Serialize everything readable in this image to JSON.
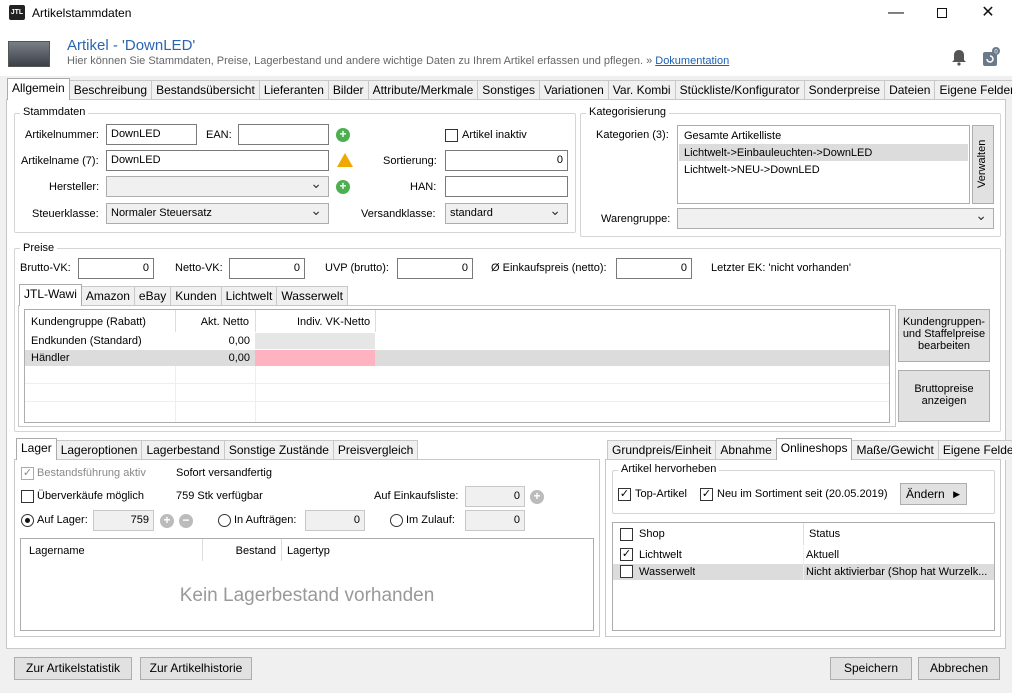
{
  "window": {
    "title": "Artikelstammdaten",
    "icon_text": "JTL"
  },
  "header": {
    "title": "Artikel - 'DownLED'",
    "description": "Hier können Sie Stammdaten, Preise, Lagerbestand und andere wichtige Daten zu Ihrem Artikel erfassen und pflegen.  »",
    "doc_link": "Dokumentation"
  },
  "main_tabs": [
    "Allgemein",
    "Beschreibung",
    "Bestandsübersicht",
    "Lieferanten",
    "Bilder",
    "Attribute/Merkmale",
    "Sonstiges",
    "Variationen",
    "Var. Kombi",
    "Stückliste/Konfigurator",
    "Sonderpreise",
    "Dateien",
    "Eigene Felder"
  ],
  "stammdaten": {
    "title": "Stammdaten",
    "artikelnummer_label": "Artikelnummer:",
    "artikelnummer": "DownLED",
    "ean_label": "EAN:",
    "ean": "",
    "inaktiv_label": "Artikel inaktiv",
    "artikelname_label": "Artikelname (7):",
    "artikelname": "DownLED",
    "sortierung_label": "Sortierung:",
    "sortierung": "0",
    "hersteller_label": "Hersteller:",
    "hersteller": "",
    "han_label": "HAN:",
    "han": "",
    "steuerklasse_label": "Steuerklasse:",
    "steuerklasse": "Normaler Steuersatz",
    "versandklasse_label": "Versandklasse:",
    "versandklasse": "standard"
  },
  "kategorisierung": {
    "title": "Kategorisierung",
    "kategorien_label": "Kategorien (3):",
    "items": [
      "Gesamte Artikelliste",
      "Lichtwelt->Einbauleuchten->DownLED",
      "Lichtwelt->NEU->DownLED"
    ],
    "verwalten": "Verwalten",
    "warengruppe_label": "Warengruppe:",
    "warengruppe": ""
  },
  "preise": {
    "title": "Preise",
    "brutto_label": "Brutto-VK:",
    "brutto": "0",
    "netto_label": "Netto-VK:",
    "netto": "0",
    "uvp_label": "UVP (brutto):",
    "uvp": "0",
    "ek_label": "Ø Einkaufspreis (netto):",
    "ek": "0",
    "letzter_ek": "Letzter EK: 'nicht vorhanden'",
    "tabs": [
      "JTL-Wawi",
      "Amazon",
      "eBay",
      "Kunden",
      "Lichtwelt",
      "Wasserwelt"
    ],
    "columns": [
      "Kundengruppe (Rabatt)",
      "Akt. Netto",
      "Indiv. VK-Netto"
    ],
    "rows": [
      {
        "gruppe": "Endkunden (Standard)",
        "netto": "0,00",
        "indiv": ""
      },
      {
        "gruppe": "Händler",
        "netto": "0,00",
        "indiv": ""
      }
    ],
    "btn_staffel": "Kundengruppen- und Staffelpreise bearbeiten",
    "btn_brutto": "Bruttopreise anzeigen"
  },
  "lager": {
    "tabs": [
      "Lager",
      "Lageroptionen",
      "Lagerbestand",
      "Sonstige Zustände",
      "Preisvergleich"
    ],
    "bestandsfuehrung": "Bestandsführung aktiv",
    "sofort": "Sofort versandfertig",
    "ueberverkaeufe": "Überverkäufe möglich",
    "verfuegbar": "759 Stk verfügbar",
    "einkaufsliste_label": "Auf Einkaufsliste:",
    "einkaufsliste": "0",
    "auf_lager_label": "Auf Lager:",
    "auf_lager": "759",
    "in_auftraegen_label": "In Aufträgen:",
    "in_auftraegen": "0",
    "im_zulauf_label": "Im Zulauf:",
    "im_zulauf": "0",
    "columns": [
      "Lagername",
      "Bestand",
      "Lagertyp"
    ],
    "empty": "Kein Lagerbestand vorhanden"
  },
  "online": {
    "tabs": [
      "Grundpreis/Einheit",
      "Abnahme",
      "Onlineshops",
      "Maße/Gewicht",
      "Eigene Felder"
    ],
    "hervorheben_title": "Artikel hervorheben",
    "top_artikel": "Top-Artikel",
    "neu": "Neu im Sortiment seit (20.05.2019)",
    "aendern": "Ändern",
    "columns": [
      "Shop",
      "Status"
    ],
    "shops": [
      {
        "name": "Lichtwelt",
        "status": "Aktuell",
        "checked": true
      },
      {
        "name": "Wasserwelt",
        "status": "Nicht aktivierbar (Shop hat Wurzelk...",
        "checked": false
      }
    ]
  },
  "footer": {
    "statistik": "Zur Artikelstatistik",
    "historie": "Zur Artikelhistorie",
    "speichern": "Speichern",
    "abbrechen": "Abbrechen"
  },
  "colors": {
    "accent": "#2a66b0",
    "highlight": "#ffb3c1",
    "selected_row": "#dcdcdc"
  }
}
